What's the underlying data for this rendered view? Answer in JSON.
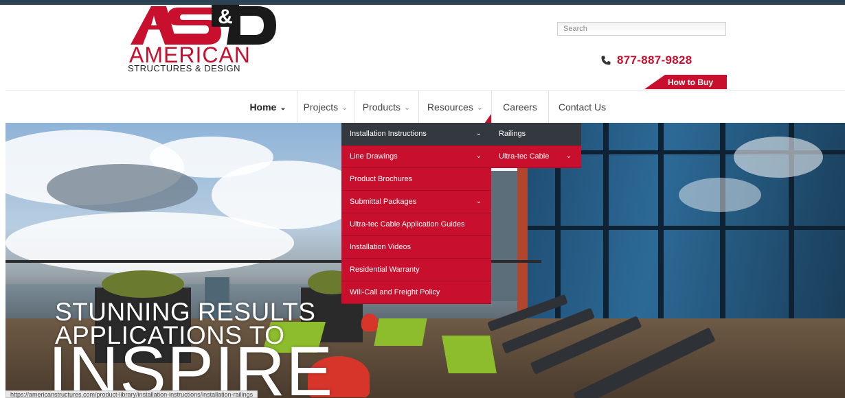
{
  "colors": {
    "accent": "#c8102e",
    "topbar": "#2c4356",
    "menu_dark": "#34383f"
  },
  "logo": {
    "mark": "AS&D",
    "word": "AMERICAN",
    "tagline": "STRUCTURES & DESIGN"
  },
  "header": {
    "search_placeholder": "Search",
    "phone_icon": "phone-icon",
    "phone": "877-887-9828",
    "how_to_buy": "How to Buy"
  },
  "nav": {
    "items": [
      {
        "label": "Home",
        "chevron": "⌄"
      },
      {
        "label": "Projects",
        "chevron": "⌄"
      },
      {
        "label": "Products",
        "chevron": "⌄"
      },
      {
        "label": "Resources",
        "chevron": "⌄"
      },
      {
        "label": "Careers"
      },
      {
        "label": "Contact Us"
      }
    ]
  },
  "resources_menu": {
    "items": [
      {
        "label": "Installation Instructions",
        "chevron": "⌄",
        "state": "hover"
      },
      {
        "label": "Line Drawings",
        "chevron": "⌄"
      },
      {
        "label": "Product Brochures"
      },
      {
        "label": "Submittal Packages",
        "chevron": "⌄"
      },
      {
        "label": "Ultra-tec Cable Application Guides"
      },
      {
        "label": "Installation Videos"
      },
      {
        "label": "Residential Warranty"
      },
      {
        "label": "Will-Call and Freight Policy"
      }
    ]
  },
  "install_submenu": {
    "items": [
      {
        "label": "Railings",
        "state": "hover"
      },
      {
        "label": "Ultra-tec Cable",
        "chevron": "⌄"
      }
    ]
  },
  "hero": {
    "line1": "STUNNING RESULTS",
    "line2": "APPLICATIONS TO",
    "line3": "INSPIRE"
  },
  "status_url": "https://americanstructures.com/product-library/installation-instructions/installation-railings"
}
